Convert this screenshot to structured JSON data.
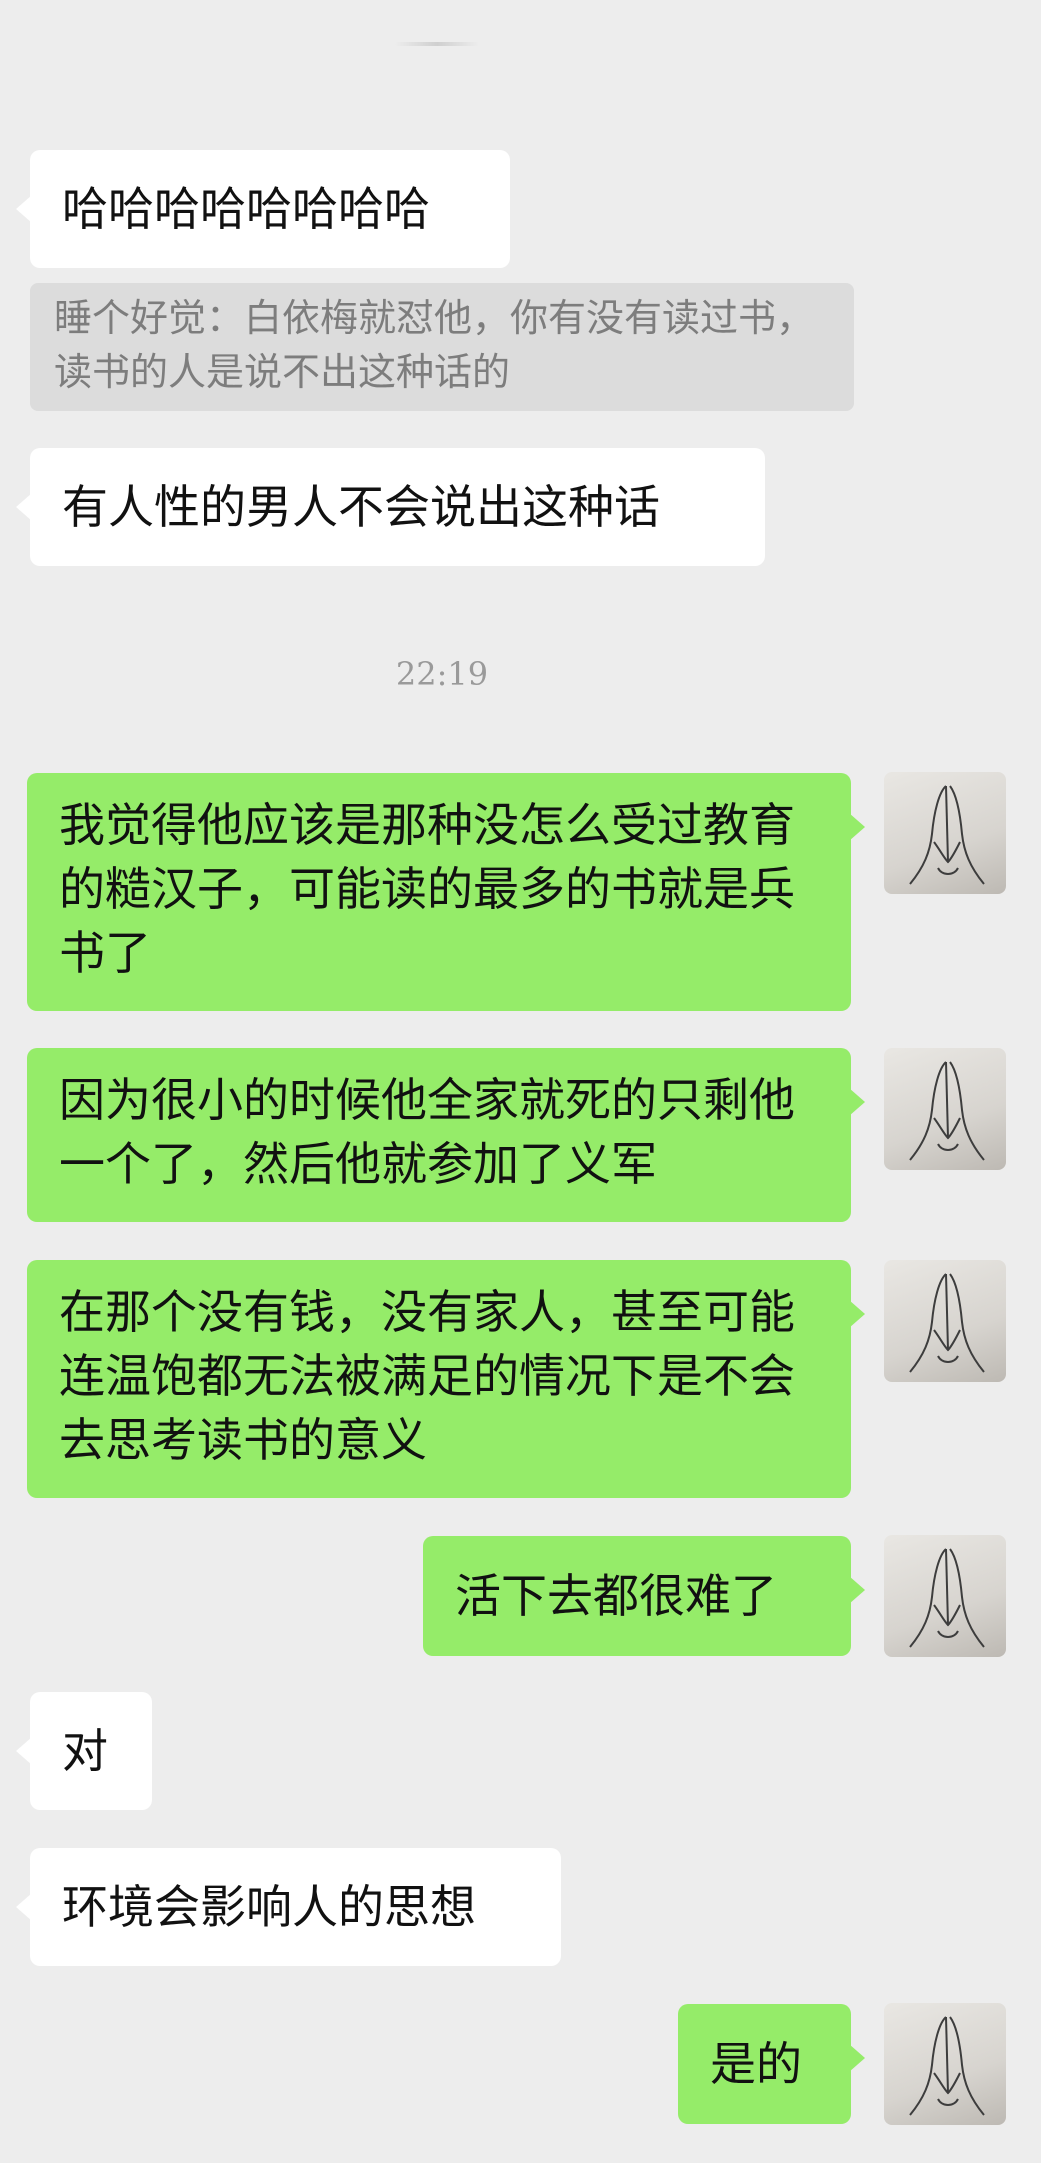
{
  "messages": [
    {
      "side": "in",
      "text": "哈哈哈哈哈哈哈哈"
    },
    {
      "side": "quote",
      "text": "睡个好觉：白依梅就怼他，你有没有读过书，读书的人是说不出这种话的"
    },
    {
      "side": "in",
      "text": "有人性的男人不会说出这种话"
    },
    {
      "side": "time",
      "text": "22:19"
    },
    {
      "side": "out",
      "text": "我觉得他应该是那种没怎么受过教育的糙汉子，可能读的最多的书就是兵书了"
    },
    {
      "side": "out",
      "text": "因为很小的时候他全家就死的只剩他一个了，然后他就参加了义军"
    },
    {
      "side": "out",
      "text": "在那个没有钱，没有家人，甚至可能连温饱都无法被满足的情况下是不会去思考读书的意义"
    },
    {
      "side": "out",
      "text": "活下去都很难了"
    },
    {
      "side": "in",
      "text": "对"
    },
    {
      "side": "in",
      "text": "环境会影响人的思想"
    },
    {
      "side": "out",
      "text": "是的"
    }
  ],
  "avatar": {
    "icon": "praying-hands-icon"
  },
  "colors": {
    "background": "#ededed",
    "incoming_bubble": "#ffffff",
    "outgoing_bubble": "#95ec69",
    "quote_bubble": "#dcdcdc"
  }
}
